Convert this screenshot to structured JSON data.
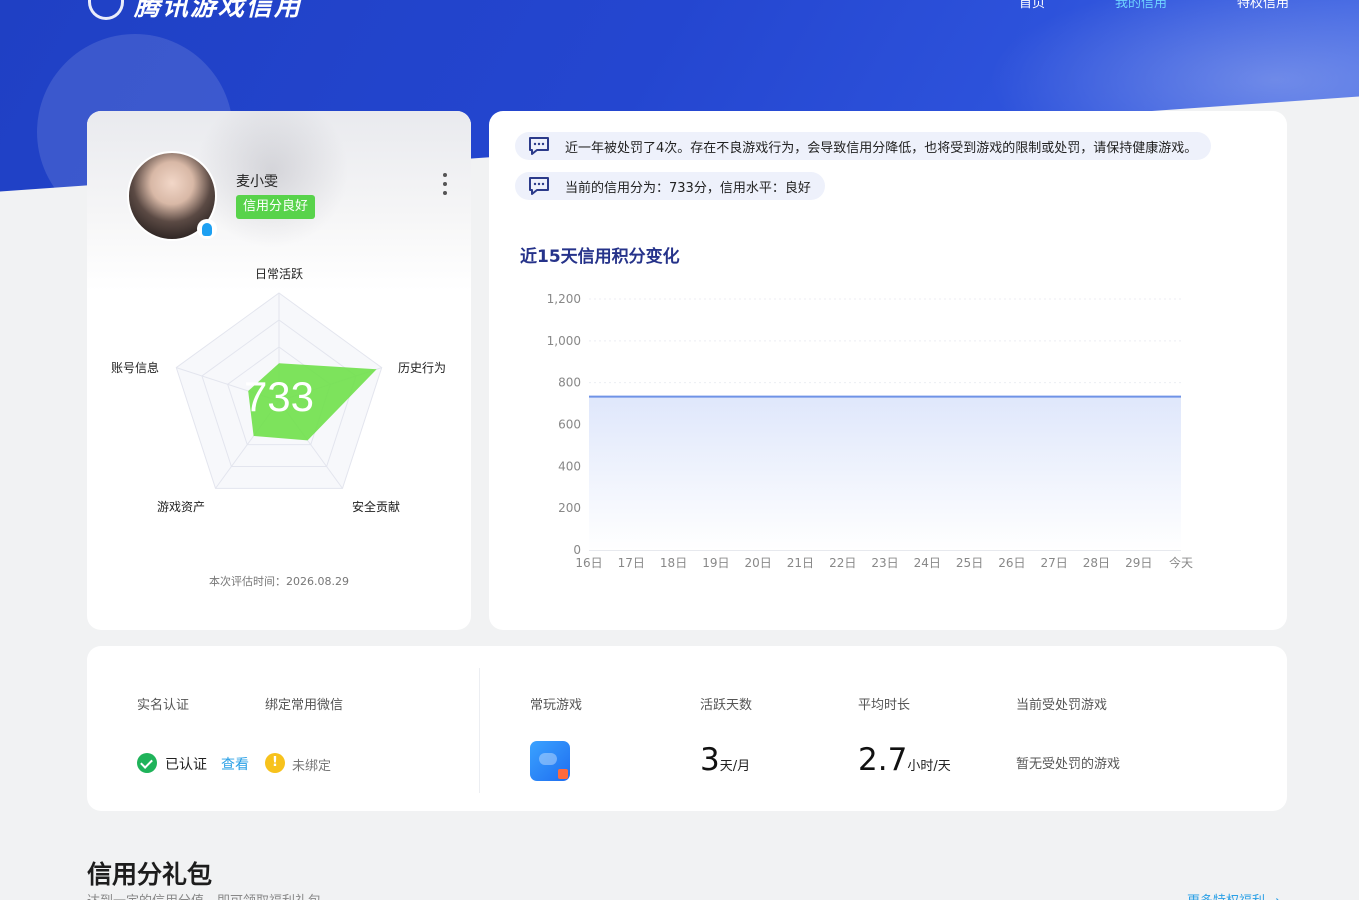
{
  "header": {
    "logo_text": "腾讯游戏信用",
    "nav": [
      {
        "label": "首页",
        "active": false
      },
      {
        "label": "我的信用",
        "active": true
      },
      {
        "label": "特权信用",
        "active": false
      }
    ]
  },
  "profile": {
    "username": "麦小雯",
    "credit_badge": "信用分良好",
    "score": "733",
    "radar_axes": [
      "日常活跃",
      "历史行为",
      "安全贡献",
      "游戏资产",
      "账号信息"
    ],
    "radar_values": [
      0.35,
      0.95,
      0.45,
      0.4,
      0.3
    ],
    "eval_time": "本次评估时间：2026.08.29"
  },
  "notices": [
    "近一年被处罚了4次。存在不良游戏行为，会导致信用分降低，也将受到游戏的限制或处罚，请保持健康游戏。",
    "当前的信用分为：733分，信用水平：良好"
  ],
  "chart_title": "近15天信用积分变化",
  "chart_data": {
    "type": "area",
    "categories": [
      "16日",
      "17日",
      "18日",
      "19日",
      "20日",
      "21日",
      "22日",
      "23日",
      "24日",
      "25日",
      "26日",
      "27日",
      "28日",
      "29日",
      "今天"
    ],
    "values": [
      733,
      733,
      733,
      733,
      733,
      733,
      733,
      733,
      733,
      733,
      733,
      733,
      733,
      733,
      733
    ],
    "y_ticks": [
      "0",
      "200",
      "400",
      "600",
      "800",
      "1,000",
      "1,200"
    ],
    "ylim": [
      0,
      1200
    ],
    "grid": true,
    "color": "#6f93e6"
  },
  "stats": {
    "real_name_label": "实名认证",
    "wechat_label": "绑定常用微信",
    "real_name_status": "已认证",
    "view_link": "查看",
    "wechat_status": "未绑定",
    "fav_game_label": "常玩游戏",
    "active_days_label": "活跃天数",
    "active_days_value": "3",
    "active_days_unit": "天/月",
    "avg_time_label": "平均时长",
    "avg_time_value": "2.7",
    "avg_time_unit": "小时/天",
    "penalty_label": "当前受处罚游戏",
    "penalty_value": "暂无受处罚的游戏"
  },
  "gift": {
    "title": "信用分礼包",
    "subtitle": "达到一定的信用分值，即可领取福利礼包",
    "more_link": "更多特权福利 →"
  }
}
